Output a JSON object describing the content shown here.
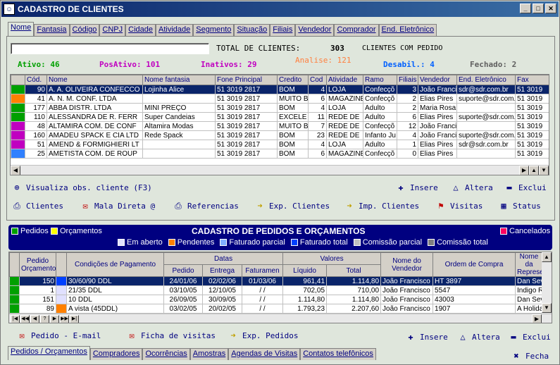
{
  "title": "CADASTRO DE CLIENTES",
  "tabs": [
    "Nome",
    "Fantasia",
    "Código",
    "CNPJ",
    "Cidade",
    "Atividade",
    "Segmento",
    "Situação",
    "Filiais",
    "Vendedor",
    "Comprador",
    "End. Eletrônico"
  ],
  "search": {
    "value": ""
  },
  "totals": {
    "label": "TOTAL DE CLIENTES:",
    "count": "303",
    "suffix": "CLIENTES COM PEDIDO"
  },
  "stats": {
    "ativo": {
      "label": "Ativo:",
      "value": "46"
    },
    "posativo": {
      "label": "PosAtivo:",
      "value": "101"
    },
    "inativos": {
      "label": "Inativos:",
      "value": "29"
    },
    "analise": {
      "label": "Analise:",
      "value": "121"
    },
    "desabil": {
      "label": "Desabil.:",
      "value": "4"
    },
    "fechado": {
      "label": "Fechado:",
      "value": "2"
    }
  },
  "clients": {
    "columns": [
      "Cód.",
      "Nome",
      "Nome fantasia",
      "Fone Principal",
      "Credito",
      "Cod",
      "Atividade",
      "Ramo",
      "Filiais",
      "Vendedor",
      "End. Eletrônico",
      "Fax"
    ],
    "rows": [
      {
        "color": "#00a000",
        "cells": [
          "90",
          "A. A. OLIVEIRA CONFECCO",
          "Lojinha Alice",
          "51 3019 2817",
          "BOM",
          "4",
          "LOJA",
          "Confecçõ",
          "3",
          "João Francis",
          "sdr@sdr.com.br",
          "51 3019"
        ],
        "sel": true
      },
      {
        "color": "#ff8000",
        "cells": [
          "41",
          "A. N. M. CONF. LTDA",
          "",
          "51 3019 2817",
          "MUITO B",
          "6",
          "MAGAZINE",
          "Confecçõ",
          "2",
          "Elias Pires",
          "suporte@sdr.com.br",
          "51 3019"
        ]
      },
      {
        "color": "#00a000",
        "cells": [
          "177",
          "ABBA DISTR. LTDA",
          "MINI PREÇO",
          "51 3019 2817",
          "BOM",
          "4",
          "LOJA",
          "Adulto",
          "2",
          "Maria Rosa",
          "",
          "51 3019"
        ]
      },
      {
        "color": "#00a000",
        "cells": [
          "110",
          "ALESSANDRA DE R. FERR",
          "Super Candeias",
          "51 3019 2817",
          "EXCELE",
          "11",
          "REDE DE",
          "Adulto",
          "6",
          "Elias Pires",
          "suporte@sdr.com.br",
          "51 3019"
        ]
      },
      {
        "color": "#c000c0",
        "cells": [
          "48",
          "ALTAMIRA COM. DE CONF",
          "Altamira Modas",
          "51 3019 2817",
          "MUITO B",
          "7",
          "REDE DE",
          "Confecçõ",
          "12",
          "João Francis",
          "",
          "51 3019"
        ]
      },
      {
        "color": "#c000c0",
        "cells": [
          "160",
          "AMADEU SPACK E CIA LTD",
          "Rede Spack",
          "51 3019 2817",
          "BOM",
          "23",
          "REDE DE",
          "Infanto Ju",
          "4",
          "João Francis",
          "suporte@sdr.com.br",
          "51 3019"
        ]
      },
      {
        "color": "#c000c0",
        "cells": [
          "51",
          "AMEND & FORMIGHIERI LT",
          "",
          "51 3019 2817",
          "BOM",
          "4",
          "LOJA",
          "Adulto",
          "1",
          "Elias Pires",
          "sdr@sdr.com.br",
          "51 3019"
        ]
      },
      {
        "color": "#3080ff",
        "cells": [
          "25",
          "AMETISTA COM. DE ROUP",
          "",
          "51 3019 2817",
          "BOM",
          "6",
          "MAGAZINE",
          "Confecçõ",
          "0",
          "Elias Pires",
          "",
          "51 3019"
        ]
      }
    ]
  },
  "actions1": {
    "obs": "Visualiza obs. cliente (F3)",
    "insere": "Insere",
    "altera": "Altera",
    "exclui": "Exclui"
  },
  "actions2": {
    "clientes": "Clientes",
    "mala": "Mala Direta @",
    "referencias": "Referencias",
    "exp": "Exp. Clientes",
    "imp": "Imp. Clientes",
    "visitas": "Visitas",
    "status": "Status"
  },
  "orders": {
    "header": "CADASTRO DE PEDIDOS E ORÇAMENTOS",
    "pedidos": "Pedidos",
    "orcamentos": "Orçamentos",
    "cancelados": "Cancelados",
    "legend": [
      {
        "label": "Em aberto",
        "color": "#e0e0ff"
      },
      {
        "label": "Pendentes",
        "color": "#ff8000"
      },
      {
        "label": "Faturado parcial",
        "color": "#80b0ff"
      },
      {
        "label": "Faturado total",
        "color": "#0040ff"
      },
      {
        "label": "Comissão parcial",
        "color": "#c0c0c0"
      },
      {
        "label": "Comissão total",
        "color": "#808080"
      }
    ],
    "groupHeaders": {
      "pedido": "Pedido Orçamento",
      "cond": "Condições de Pagamento",
      "datas": "Datas",
      "valores": "Valores",
      "vendedor": "Nome do Vendedor",
      "compra": "Ordem de Compra",
      "repr": "Nome da Representada"
    },
    "subHeaders": [
      "Pedido",
      "Entrega",
      "Faturamen",
      "Líquido",
      "Total"
    ],
    "rows": [
      {
        "color": "#00a000",
        "status": "#0040ff",
        "cells": [
          "150",
          "30/60/90 DDL",
          "24/01/06",
          "02/02/06",
          "01/03/06",
          "961,41",
          "1.114,80",
          "João Francisco",
          "HT 3897",
          "Dan Severn Esportes Ltda"
        ],
        "sel": true
      },
      {
        "color": "#00a000",
        "status": "#e0e0ff",
        "cells": [
          "1",
          "21/35 DDL",
          "03/10/05",
          "12/10/05",
          "/  /",
          "702,05",
          "710,00",
          "João Francisco",
          "5547",
          "Indigo Rivers Jeans Ltda"
        ]
      },
      {
        "color": "#00a000",
        "status": "#e0e0ff",
        "cells": [
          "151",
          "10 DDL",
          "26/09/05",
          "30/09/05",
          "/  /",
          "1.114,80",
          "1.114,80",
          "João Francisco",
          "43003",
          "Dan Severn Esportes Ltda"
        ]
      },
      {
        "color": "#00a000",
        "status": "#ff8000",
        "cells": [
          "89",
          "A vista (45DDL)",
          "03/02/05",
          "20/02/05",
          "/  /",
          "1.793,23",
          "2.207,60",
          "João Francisco",
          "1907",
          "A Holiday Guide Confecçõ"
        ]
      }
    ]
  },
  "actions3": {
    "pedido_email": "Pedido - E-mail",
    "ficha": "Ficha de visitas",
    "exp_pedidos": "Exp. Pedidos",
    "insere": "Insere",
    "altera": "Altera",
    "exclui": "Exclui"
  },
  "bottomTabs": [
    "Pedidos / Orçamentos",
    "Compradores",
    "Ocorrências",
    "Amostras",
    "Agendas de Visitas",
    "Contatos telefônicos"
  ],
  "fecha": "Fecha"
}
